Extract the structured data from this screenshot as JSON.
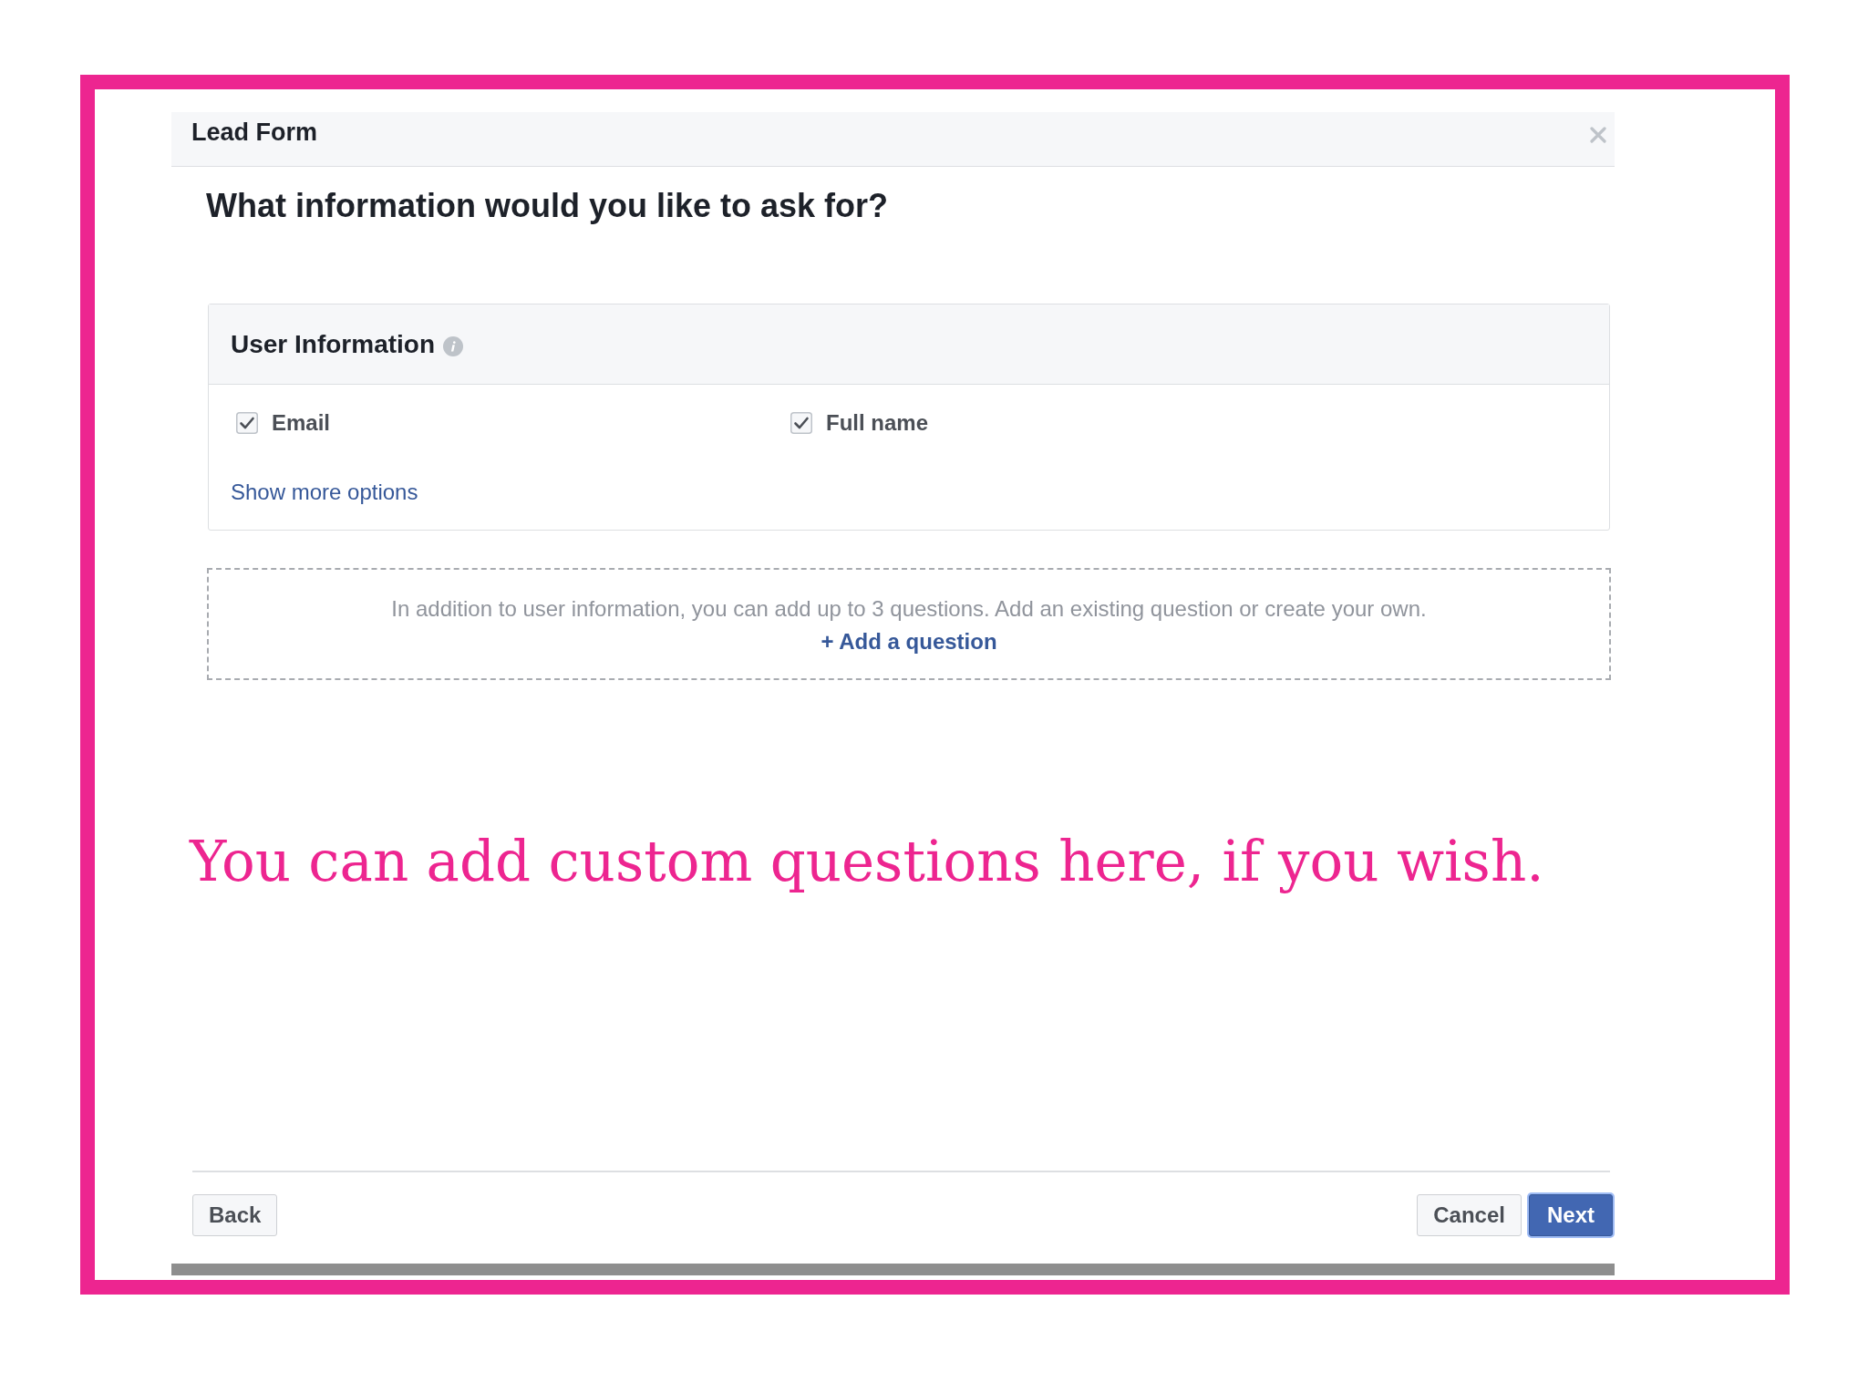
{
  "dialog": {
    "title": "Lead Form",
    "heading": "What information would you like to ask for?"
  },
  "user_information": {
    "title": "User Information",
    "fields": [
      {
        "label": "Email",
        "checked": true
      },
      {
        "label": "Full name",
        "checked": true
      }
    ],
    "more_link": "Show more options"
  },
  "custom_questions": {
    "text": "In addition to user information, you can add up to 3 questions. Add an existing question or create your own.",
    "add_link": "+ Add a question"
  },
  "annotation": "You can add custom questions here, if you wish.",
  "footer": {
    "left_buttons": [
      {
        "label": "Back",
        "primary": false,
        "focused": false
      }
    ],
    "right_buttons": [
      {
        "label": "Cancel",
        "primary": false,
        "focused": false
      },
      {
        "label": "Next",
        "primary": true,
        "focused": true
      }
    ]
  }
}
